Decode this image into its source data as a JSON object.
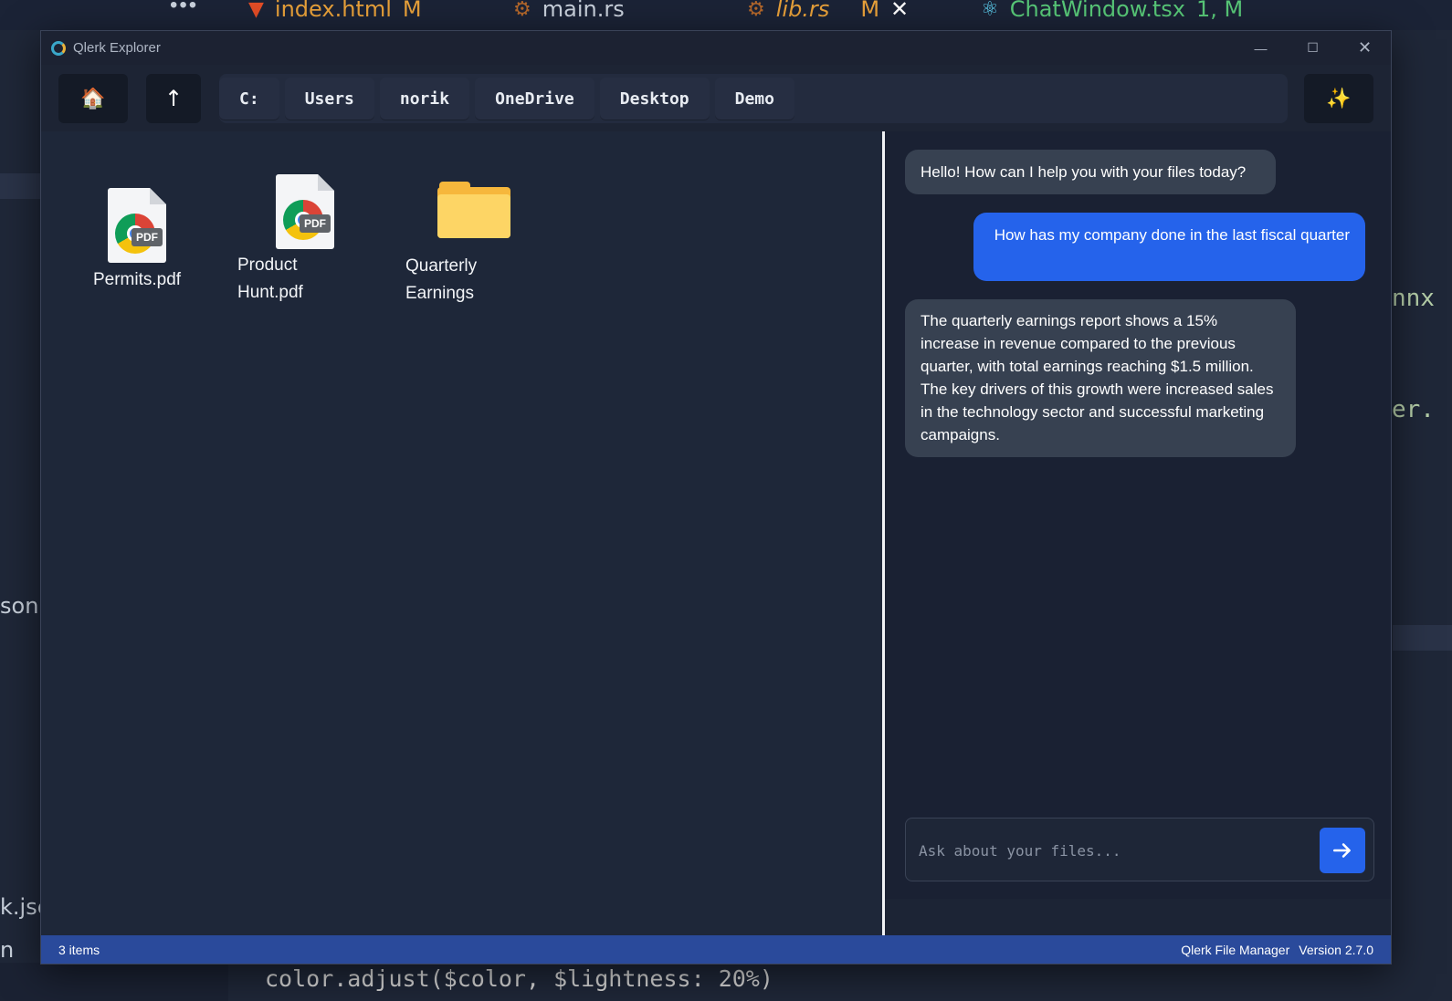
{
  "editor": {
    "more_label": "•••",
    "tabs": [
      {
        "icon": "html5-icon",
        "label": "index.html",
        "status": "M"
      },
      {
        "icon": "rust-icon",
        "label": "main.rs",
        "status": ""
      },
      {
        "icon": "rust-icon",
        "label": "lib.rs",
        "status": "M"
      },
      {
        "icon": "react-icon",
        "label": "ChatWindow.tsx",
        "status": "1, M"
      }
    ],
    "background_fragments": {
      "right_1": "nnx",
      "right_2": "er.",
      "left_1": "son",
      "left_2": "k.jsc",
      "left_3": "n",
      "bottom_code": "color.adjust($color, $lightness: 20%)"
    },
    "colors": {
      "html_tab": "#e8a13a",
      "rust_tab": "#c9d1dc",
      "librs_tab": "#e8a13a",
      "react_tab": "#58c878",
      "code_green": "#b5cea8"
    }
  },
  "window": {
    "title": "Qlerk Explorer",
    "controls": {
      "minimize": "—",
      "maximize": "☐",
      "close": "✕"
    }
  },
  "toolbar": {
    "home_button": {
      "icon": "home-icon",
      "glyph": "🏠"
    },
    "up_button": {
      "icon": "arrow-up-icon",
      "glyph": "↑"
    },
    "ai_button": {
      "icon": "sparkles-icon",
      "glyph": "✨"
    },
    "breadcrumbs": [
      "C:",
      "Users",
      "norik",
      "OneDrive",
      "Desktop",
      "Demo"
    ]
  },
  "files": [
    {
      "name": "Permits.pdf",
      "type": "pdf",
      "icon": "pdf-icon"
    },
    {
      "name": "Product\nHunt.pdf",
      "type": "pdf",
      "icon": "pdf-icon"
    },
    {
      "name": "Quarterly\nEarnings",
      "type": "folder",
      "icon": "folder-icon"
    }
  ],
  "pdf_badge": "PDF",
  "chat": {
    "messages": [
      {
        "role": "assistant",
        "text": "Hello! How can I help you with your files today?"
      },
      {
        "role": "user",
        "text": "How has my company done in the last fiscal quarter"
      },
      {
        "role": "assistant",
        "text": "The quarterly earnings report shows a 15% increase in revenue compared to the previous quarter, with total earnings reaching $1.5 million. The key drivers of this growth were increased sales in the technology sector and successful marketing campaigns."
      }
    ],
    "input_placeholder": "Ask about your files...",
    "input_value": "",
    "send_icon": "arrow-right-icon"
  },
  "status": {
    "item_count": "3 items",
    "app_name": "Qlerk File Manager",
    "version": "Version 2.7.0"
  },
  "colors": {
    "accent": "#2563eb",
    "statusbar": "#2a4a9b",
    "ai_bubble": "#374151",
    "folder": "#fdd565"
  }
}
